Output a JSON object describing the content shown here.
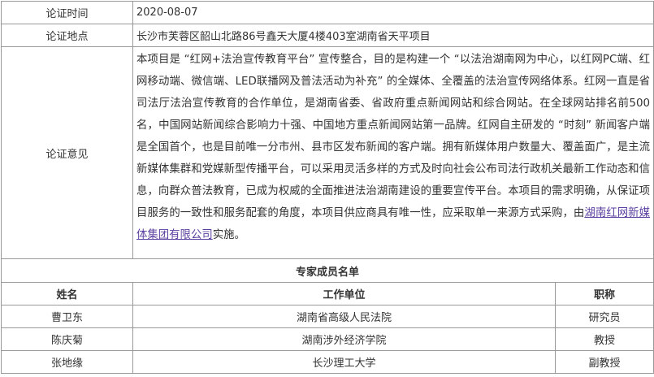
{
  "info": {
    "date_label": "论证时间",
    "date_value": "2020-08-07",
    "location_label": "论证地点",
    "location_value": "长沙市芙蓉区韶山北路86号鑫天大厦4楼403室湖南省天平项目",
    "opinion_label": "论证意见",
    "opinion_text_before": "本项目是 “红网+法治宣传教育平台” 宣传整合，目的是构建一个 “以法治湖南网为中心，以红网PC端、红网移动端、微信端、LED联播网及普法活动为补充” 的全媒体、全覆盖的法治宣传网络体系。红网一直是省司法厅法治宣传教育的合作单位，是湖南省委、省政府重点新闻网站和综合网站。在全球网站排名前500名，中国网站新闻综合影响力十强、中国地方重点新闻网站第一品牌。红网自主研发的 “时刻” 新闻客户端是全国首个，也是目前唯一分市州、县市区发布新闻的客户端。拥有新媒体用户数量大、覆盖面广，是主流新媒体集群和党媒新型传播平台，可以采用灵活多样的方式及时向社会公布司法行政机关最新工作动态和信息，向群众普法教育，已成为权威的全面推进法治湖南建设的重要宣传平台。本项目的需求明确，从保证项目服务的一致性和服务配套的角度，本项目供应商具有唯一性，应采取单一来源方式采购，由",
    "opinion_link": "湖南红网新媒体集团有限公司",
    "opinion_text_after": "实施。"
  },
  "experts": {
    "section_title": "专家成员名单",
    "headers": {
      "name": "姓名",
      "unit": "工作单位",
      "title": "职称"
    },
    "rows": [
      {
        "name": "曹卫东",
        "unit": "湖南省高级人民法院",
        "title": "研究员"
      },
      {
        "name": "陈庆菊",
        "unit": "湖南涉外经济学院",
        "title": "教授"
      },
      {
        "name": "张地缘",
        "unit": "长沙理工大学",
        "title": "副教授"
      }
    ]
  }
}
